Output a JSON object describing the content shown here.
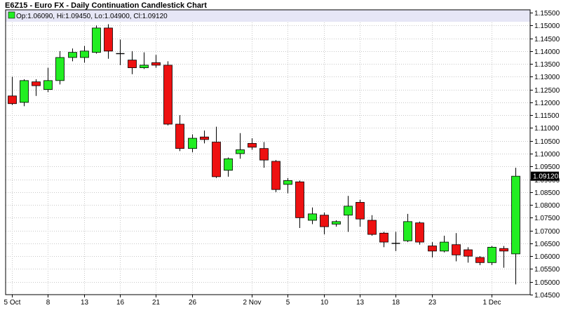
{
  "chart_data": {
    "type": "candlestick",
    "title": "E6Z15 - Euro FX - Daily Continuation Candlestick Chart",
    "legend": "Op:1.06090, Hi:1.09450, Lo:1.04900, Cl:1.09120",
    "last_price_label": "1.09120",
    "colors": {
      "up": "#22ee22",
      "down": "#ee1111",
      "outline": "#000000",
      "grid": "#c8c8c8",
      "header": "#e6e6f6"
    },
    "ylim": [
      1.045,
      1.155
    ],
    "y_ticks": [
      "1.04500",
      "1.05000",
      "1.05500",
      "1.06000",
      "1.06500",
      "1.07000",
      "1.07500",
      "1.08000",
      "1.08500",
      "1.09000",
      "1.09500",
      "1.10000",
      "1.10500",
      "1.11000",
      "1.11500",
      "1.12000",
      "1.12500",
      "1.13000",
      "1.13500",
      "1.14000",
      "1.14500",
      "1.15000",
      "1.15500"
    ],
    "x_ticks": [
      {
        "label": "5 Oct",
        "index": 0
      },
      {
        "label": "8",
        "index": 3
      },
      {
        "label": "13",
        "index": 6
      },
      {
        "label": "16",
        "index": 9
      },
      {
        "label": "21",
        "index": 12
      },
      {
        "label": "26",
        "index": 15
      },
      {
        "label": "2 Nov",
        "index": 20
      },
      {
        "label": "5",
        "index": 23
      },
      {
        "label": "10",
        "index": 26
      },
      {
        "label": "13",
        "index": 29
      },
      {
        "label": "18",
        "index": 32
      },
      {
        "label": "23",
        "index": 35
      },
      {
        "label": "1 Dec",
        "index": 40
      }
    ],
    "candles": [
      {
        "date": "Oct 5",
        "open": 1.1225,
        "high": 1.13,
        "low": 1.119,
        "close": 1.1195
      },
      {
        "date": "Oct 6",
        "open": 1.12,
        "high": 1.129,
        "low": 1.1185,
        "close": 1.1285
      },
      {
        "date": "Oct 7",
        "open": 1.128,
        "high": 1.129,
        "low": 1.1225,
        "close": 1.1265
      },
      {
        "date": "Oct 8",
        "open": 1.125,
        "high": 1.1335,
        "low": 1.124,
        "close": 1.1285
      },
      {
        "date": "Oct 9",
        "open": 1.1285,
        "high": 1.14,
        "low": 1.127,
        "close": 1.1375
      },
      {
        "date": "Oct 12",
        "open": 1.1375,
        "high": 1.141,
        "low": 1.136,
        "close": 1.1395
      },
      {
        "date": "Oct 13",
        "open": 1.1375,
        "high": 1.142,
        "low": 1.1355,
        "close": 1.14
      },
      {
        "date": "Oct 14",
        "open": 1.1395,
        "high": 1.15,
        "low": 1.139,
        "close": 1.149
      },
      {
        "date": "Oct 15",
        "open": 1.149,
        "high": 1.1505,
        "low": 1.137,
        "close": 1.14
      },
      {
        "date": "Oct 16",
        "open": 1.139,
        "high": 1.1445,
        "low": 1.1345,
        "close": 1.139
      },
      {
        "date": "Oct 19",
        "open": 1.1365,
        "high": 1.14,
        "low": 1.131,
        "close": 1.1335
      },
      {
        "date": "Oct 20",
        "open": 1.1335,
        "high": 1.1395,
        "low": 1.133,
        "close": 1.1345
      },
      {
        "date": "Oct 21",
        "open": 1.1355,
        "high": 1.1385,
        "low": 1.1335,
        "close": 1.1345
      },
      {
        "date": "Oct 22",
        "open": 1.1345,
        "high": 1.136,
        "low": 1.111,
        "close": 1.1115
      },
      {
        "date": "Oct 23",
        "open": 1.1115,
        "high": 1.115,
        "low": 1.101,
        "close": 1.102
      },
      {
        "date": "Oct 26",
        "open": 1.102,
        "high": 1.1075,
        "low": 1.1005,
        "close": 1.106
      },
      {
        "date": "Oct 27",
        "open": 1.1065,
        "high": 1.109,
        "low": 1.104,
        "close": 1.1055
      },
      {
        "date": "Oct 28",
        "open": 1.1045,
        "high": 1.1105,
        "low": 1.0905,
        "close": 1.091
      },
      {
        "date": "Oct 29",
        "open": 1.0935,
        "high": 1.0985,
        "low": 1.091,
        "close": 1.098
      },
      {
        "date": "Oct 30",
        "open": 1.1,
        "high": 1.108,
        "low": 1.098,
        "close": 1.1015
      },
      {
        "date": "Nov 2",
        "open": 1.104,
        "high": 1.106,
        "low": 1.1015,
        "close": 1.1025
      },
      {
        "date": "Nov 3",
        "open": 1.102,
        "high": 1.1045,
        "low": 1.0945,
        "close": 1.0975
      },
      {
        "date": "Nov 4",
        "open": 1.097,
        "high": 1.0975,
        "low": 1.085,
        "close": 1.086
      },
      {
        "date": "Nov 5",
        "open": 1.088,
        "high": 1.0905,
        "low": 1.0845,
        "close": 1.0895
      },
      {
        "date": "Nov 6",
        "open": 1.089,
        "high": 1.0895,
        "low": 1.071,
        "close": 1.075
      },
      {
        "date": "Nov 9",
        "open": 1.074,
        "high": 1.079,
        "low": 1.0725,
        "close": 1.0765
      },
      {
        "date": "Nov 10",
        "open": 1.076,
        "high": 1.077,
        "low": 1.0685,
        "close": 1.0715
      },
      {
        "date": "Nov 11",
        "open": 1.0725,
        "high": 1.074,
        "low": 1.0715,
        "close": 1.0735
      },
      {
        "date": "Nov 12",
        "open": 1.076,
        "high": 1.0835,
        "low": 1.0695,
        "close": 1.0795
      },
      {
        "date": "Nov 13",
        "open": 1.081,
        "high": 1.082,
        "low": 1.0715,
        "close": 1.0745
      },
      {
        "date": "Nov 16",
        "open": 1.074,
        "high": 1.076,
        "low": 1.068,
        "close": 1.0685
      },
      {
        "date": "Nov 17",
        "open": 1.069,
        "high": 1.0695,
        "low": 1.0635,
        "close": 1.0655
      },
      {
        "date": "Nov 18",
        "open": 1.065,
        "high": 1.0695,
        "low": 1.062,
        "close": 1.065
      },
      {
        "date": "Nov 19",
        "open": 1.066,
        "high": 1.0765,
        "low": 1.0655,
        "close": 1.0735
      },
      {
        "date": "Nov 20",
        "open": 1.073,
        "high": 1.0735,
        "low": 1.0645,
        "close": 1.0655
      },
      {
        "date": "Nov 23",
        "open": 1.064,
        "high": 1.0655,
        "low": 1.0595,
        "close": 1.062
      },
      {
        "date": "Nov 24",
        "open": 1.062,
        "high": 1.068,
        "low": 1.0615,
        "close": 1.0655
      },
      {
        "date": "Nov 25",
        "open": 1.0645,
        "high": 1.069,
        "low": 1.058,
        "close": 1.0605
      },
      {
        "date": "Nov 26",
        "open": 1.0625,
        "high": 1.0635,
        "low": 1.0575,
        "close": 1.06
      },
      {
        "date": "Nov 27",
        "open": 1.0595,
        "high": 1.06,
        "low": 1.0565,
        "close": 1.0575
      },
      {
        "date": "Nov 30",
        "open": 1.0575,
        "high": 1.064,
        "low": 1.0565,
        "close": 1.0635
      },
      {
        "date": "Dec 1",
        "open": 1.063,
        "high": 1.064,
        "low": 1.0555,
        "close": 1.062
      },
      {
        "date": "Dec 2",
        "open": 1.0609,
        "high": 1.0945,
        "low": 1.049,
        "close": 1.0912
      }
    ]
  }
}
